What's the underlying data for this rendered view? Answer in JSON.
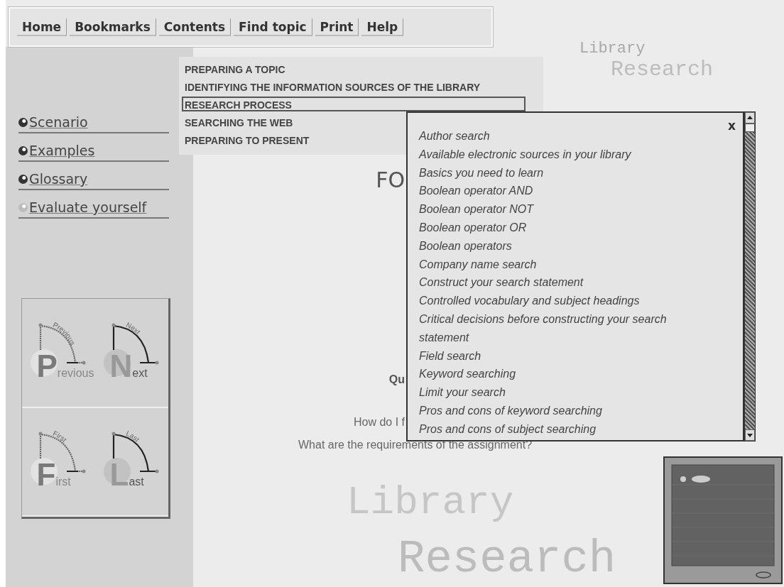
{
  "toolbar": {
    "buttons": [
      {
        "label": "Home"
      },
      {
        "label": "Bookmarks"
      },
      {
        "label": "Contents"
      },
      {
        "label": "Find topic"
      },
      {
        "label": "Print"
      },
      {
        "label": "Help"
      }
    ]
  },
  "contents_menu": {
    "items": [
      {
        "label": "PREPARING A TOPIC",
        "selected": false
      },
      {
        "label": "IDENTIFYING THE INFORMATION SOURCES OF THE LIBRARY",
        "selected": false
      },
      {
        "label": "RESEARCH PROCESS",
        "selected": true
      },
      {
        "label": "SEARCHING THE WEB",
        "selected": false
      },
      {
        "label": "PREPARING TO PRESENT",
        "selected": false
      }
    ]
  },
  "sidebar": {
    "links": [
      {
        "label": "Scenario",
        "dimmed": false
      },
      {
        "label": "Examples",
        "dimmed": false
      },
      {
        "label": "Glossary",
        "dimmed": false
      },
      {
        "label": "Evaluate yourself",
        "dimmed": true
      }
    ]
  },
  "navigation": [
    {
      "label": "Previous",
      "arc_label": "Previous",
      "disabled": true
    },
    {
      "label": "Next",
      "arc_label": "Next",
      "disabled": false
    },
    {
      "label": "First",
      "arc_label": "First",
      "disabled": true
    },
    {
      "label": "Last",
      "arc_label": "Last",
      "disabled": false
    }
  ],
  "main": {
    "heading": "FO",
    "subheading": "Qu",
    "lines": [
      "How do I f",
      "What are the requirements of the assignment?"
    ]
  },
  "banner": {
    "top": [
      "Library",
      "Research"
    ],
    "bottom": [
      "Library",
      "Research"
    ]
  },
  "topic_popup": {
    "close": "x",
    "items": [
      "Author search",
      "Available electronic sources in your library",
      "Basics you need to learn",
      "Boolean operator AND",
      "Boolean operator NOT",
      "Boolean operator OR",
      "Boolean operators",
      "Company name search",
      "Construct your search statement",
      "Controlled vocabulary and subject headings",
      "Critical decisions before constructing your search statement",
      "Field search",
      "Keyword searching",
      "Limit your search",
      "Pros and cons of keyword searching",
      "Pros and cons of subject searching"
    ]
  }
}
